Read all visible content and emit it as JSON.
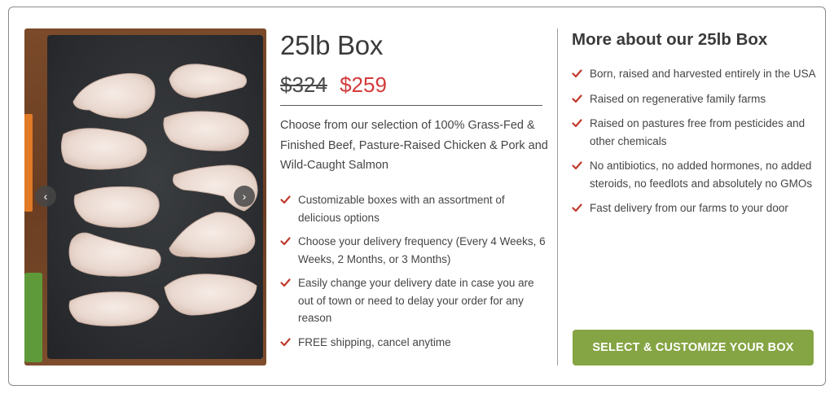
{
  "product": {
    "title": "25lb Box",
    "price_old": "$324",
    "price_new": "$259",
    "description": "Choose from our selection of 100% Grass-Fed & Finished Beef, Pasture-Raised Chicken & Pork and Wild-Caught Salmon",
    "features": [
      "Customizable boxes with an assortment of delicious options",
      "Choose your delivery frequency (Every 4 Weeks, 6 Weeks, 2 Months, or 3 Months)",
      "Easily change your delivery date in case you are out of town or need to delay your order for any reason",
      "FREE shipping, cancel anytime"
    ]
  },
  "carousel": {
    "prev_icon": "‹",
    "next_icon": "›",
    "image_subject": "raw chicken pieces on slate board"
  },
  "about": {
    "title": "More about our 25lb Box",
    "items": [
      "Born, raised and harvested entirely in the USA",
      "Raised on regenerative family farms",
      "Raised on pastures free from pesticides and other chemicals",
      "No antibiotics, no added hormones, no added steroids, no feedlots and absolutely no GMOs",
      "Fast delivery from our farms to your door"
    ]
  },
  "cta": {
    "label": "SELECT & CUSTOMIZE YOUR BOX"
  },
  "colors": {
    "sale_price": "#d43a3a",
    "check": "#c0392b",
    "cta_bg": "#85a443"
  }
}
